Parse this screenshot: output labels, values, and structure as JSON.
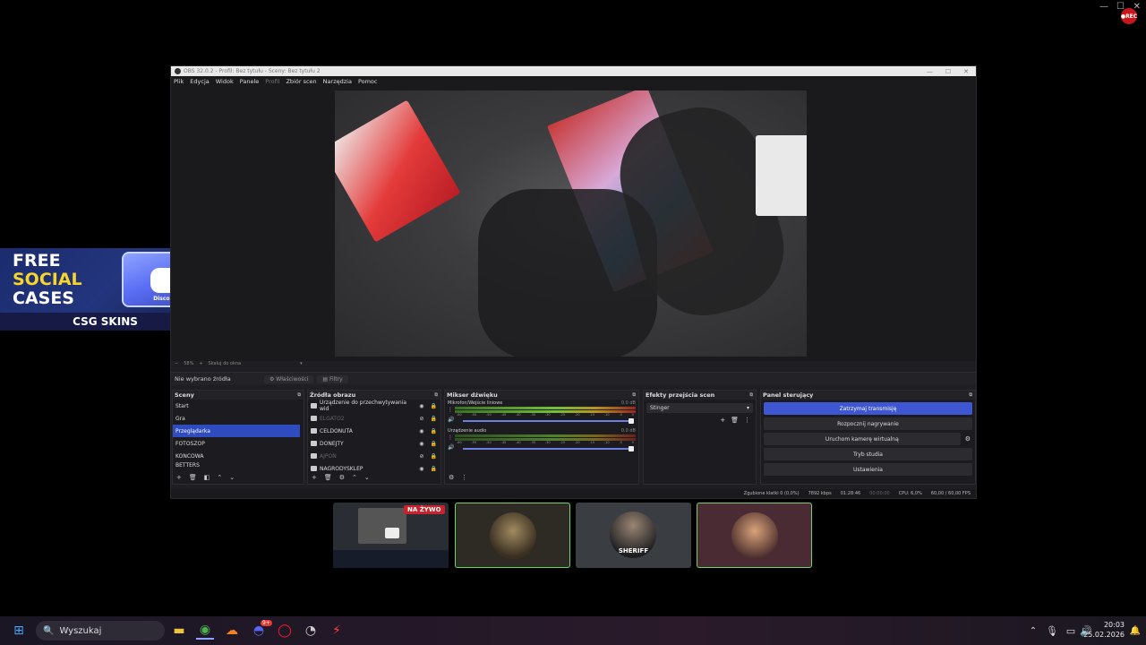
{
  "window": {
    "title": "OBS 32.0.2 - Profil: Bez tytułu - Sceny: Bez tytułu 2",
    "menu": [
      "Plik",
      "Edycja",
      "Widok",
      "Panele",
      "Profil",
      "Zbiór scen",
      "Narzędzia",
      "Pomoc"
    ],
    "disabled_menu": "Profil"
  },
  "preview": {
    "zoom": "58%",
    "scale_label": "Skaluj do okna"
  },
  "source_bar": {
    "no_source": "Nie wybrano źródła",
    "properties": "Właściwości",
    "filters": "Filtry"
  },
  "scenes": {
    "title": "Sceny",
    "items": [
      "Start",
      "Gra",
      "Przeglądarka",
      "FOTOSZOP",
      "KONCOWA",
      "BETTERS"
    ],
    "selected": "Przeglądarka"
  },
  "sources": {
    "title": "Źródła obrazu",
    "items": [
      {
        "label": "Urządzenie do przechwytywania wid",
        "dim": false
      },
      {
        "label": "ELGATO2",
        "dim": true
      },
      {
        "label": "CELDONUTA",
        "dim": false
      },
      {
        "label": "DONEJTY",
        "dim": false
      },
      {
        "label": "AJPON",
        "dim": true
      },
      {
        "label": "NAGRODYSKLEP",
        "dim": false
      }
    ]
  },
  "mixer": {
    "title": "Mikser dźwięku",
    "channels": [
      {
        "name": "Mikrofon/Wejście liniowe",
        "db": "0.0 dB",
        "level": 0.82
      },
      {
        "name": "Urządzenie audio",
        "db": "0.0 dB",
        "level": 0.55
      }
    ],
    "ticks": [
      "-60",
      "-55",
      "-50",
      "-45",
      "-40",
      "-35",
      "-30",
      "-25",
      "-20",
      "-15",
      "-10",
      "-5",
      "0"
    ]
  },
  "transitions": {
    "title": "Efekty przejścia scen",
    "selected": "Stinger"
  },
  "controls": {
    "title": "Panel sterujący",
    "buttons": [
      "Zatrzymaj transmisję",
      "Rozpocznij nagrywanie",
      "Uruchom kamerę wirtualną",
      "Tryb studia",
      "Ustawienia"
    ]
  },
  "status": {
    "dropped": "Zgubione klatki 0 (0,0%)",
    "bitrate": "7892 kbps",
    "stream_time": "01:28:46",
    "rec_time": "00:00:00",
    "cpu": "CPU: 6,0%",
    "fps": "60,00 / 60,00 FPS"
  },
  "promo": {
    "line1": "FREE",
    "line2": "SOCIAL",
    "line3": "CASES",
    "brand": "CSG SKINS",
    "case_label": "Discord"
  },
  "participants": {
    "live_badge": "NA ŻYWO",
    "sheriff_label": "SHERIFF"
  },
  "taskbar": {
    "search_placeholder": "Wyszukaj",
    "time": "20:03",
    "date": "25.02.2026",
    "discord_badge": "9+"
  },
  "colors": {
    "accent": "#3e56d1",
    "live": "#c8232c",
    "speaking_border": "#6fd46b"
  }
}
